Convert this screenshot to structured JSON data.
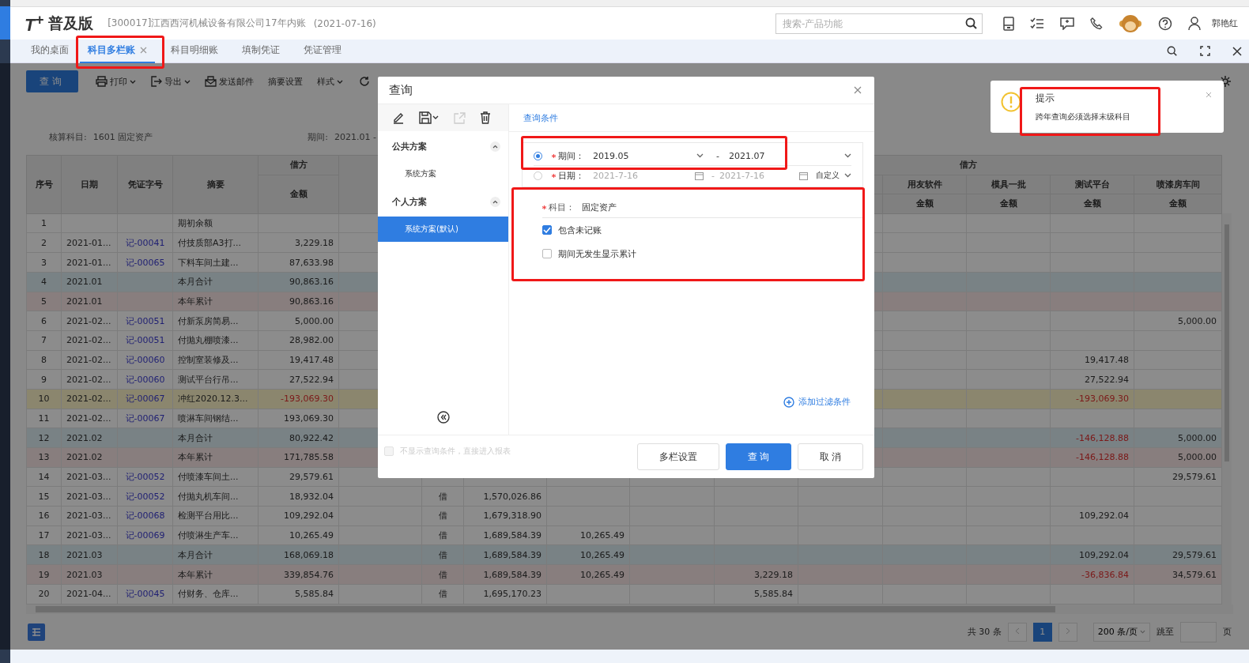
{
  "header": {
    "logo": "T$^{+}$",
    "product": "普及版",
    "company": "[300017]江西西河机械设备有限公司17年内账",
    "date": "(2021-07-16)",
    "search": {
      "placeholder": "搜索-产品功能"
    },
    "user": "郭艳红"
  },
  "tabs": [
    {
      "label": "我的桌面",
      "selected": false
    },
    {
      "label": "科目多栏账",
      "selected": true
    },
    {
      "label": "科目明细账",
      "selected": false
    },
    {
      "label": "填制凭证",
      "selected": false
    },
    {
      "label": "凭证管理",
      "selected": false
    }
  ],
  "toolbar": {
    "query_button": "查询",
    "items": [
      {
        "kind": "print",
        "label": "打印",
        "dropdown": true
      },
      {
        "kind": "export",
        "label": "导出",
        "dropdown": true
      },
      {
        "kind": "mail",
        "label": "发送邮件",
        "dropdown": false
      },
      {
        "kind": "plain",
        "label": "摘要设置",
        "dropdown": false
      },
      {
        "kind": "plain",
        "label": "样式",
        "dropdown": true
      }
    ]
  },
  "filter_summary": {
    "account_label": "核算科目:",
    "account": "1601 固定资产",
    "period_label": "期间:",
    "period": "2021.01 -"
  },
  "table": {
    "header": {
      "seq": "序号",
      "date": "日期",
      "voucher": "凭证字号",
      "summary": "摘要",
      "debit_group": "借方",
      "debit_amount": "金额",
      "right_group": "借方",
      "right_columns": [
        {
          "name": "用友软件",
          "sub": "金额"
        },
        {
          "name": "模具一批",
          "sub": "金额"
        },
        {
          "name": "测试平台",
          "sub": "金额"
        },
        {
          "name": "喷漆房车间",
          "sub": "金额"
        }
      ]
    },
    "rows": [
      {
        "kind": "entry",
        "selected": false,
        "cells": {
          "seq": "1",
          "summary": "期初余额"
        }
      },
      {
        "kind": "entry",
        "selected": false,
        "cells": {
          "seq": "2",
          "date": "2021-01...",
          "voucher": "记-00041",
          "summary": "付技质部A3打...",
          "debit_amount": "3,229.18"
        }
      },
      {
        "kind": "entry",
        "selected": false,
        "cells": {
          "seq": "3",
          "date": "2021-01...",
          "voucher": "记-00065",
          "summary": "下料车间土建...",
          "debit_amount": "87,633.98"
        }
      },
      {
        "kind": "month_total",
        "selected": false,
        "cells": {
          "seq": "4",
          "date": "2021.01",
          "summary": "本月合计",
          "debit_amount": "90,863.16"
        }
      },
      {
        "kind": "year_total",
        "selected": false,
        "cells": {
          "seq": "5",
          "date": "2021.01",
          "summary": "本年累计",
          "debit_amount": "90,863.16"
        }
      },
      {
        "kind": "entry",
        "selected": false,
        "cells": {
          "seq": "6",
          "date": "2021-02...",
          "voucher": "记-00051",
          "summary": "付新泵房简易...",
          "debit_amount": "5,000.00",
          "amount_4": "5,000.00"
        }
      },
      {
        "kind": "entry",
        "selected": false,
        "cells": {
          "seq": "7",
          "date": "2021-02...",
          "voucher": "记-00051",
          "summary": "付抛丸棚喷漆...",
          "debit_amount": "28,982.00"
        }
      },
      {
        "kind": "entry",
        "selected": false,
        "cells": {
          "seq": "8",
          "date": "2021-02...",
          "voucher": "记-00060",
          "summary": "控制室装修及...",
          "debit_amount": "19,417.48",
          "amount_3": "19,417.48"
        }
      },
      {
        "kind": "entry",
        "selected": false,
        "cells": {
          "seq": "9",
          "date": "2021-02...",
          "voucher": "记-00060",
          "summary": "测试平台行吊...",
          "debit_amount": "27,522.94",
          "amount_3": "27,522.94"
        }
      },
      {
        "kind": "entry",
        "selected": true,
        "cells": {
          "seq": "10",
          "date": "2021-02...",
          "voucher": "记-00067",
          "summary": "冲红2020.12.3...",
          "debit_amount": "-193,069.30",
          "amount_3": "-193,069.30"
        }
      },
      {
        "kind": "entry",
        "selected": false,
        "cells": {
          "seq": "11",
          "date": "2021-02...",
          "voucher": "记-00067",
          "summary": "喷淋车间钢结...",
          "debit_amount": "193,069.30"
        }
      },
      {
        "kind": "month_total",
        "selected": false,
        "cells": {
          "seq": "12",
          "date": "2021.02",
          "summary": "本月合计",
          "debit_amount": "80,922.42",
          "amount_3": "-146,128.88",
          "amount_4": "5,000.00"
        }
      },
      {
        "kind": "year_total",
        "selected": false,
        "cells": {
          "seq": "13",
          "date": "2021.02",
          "summary": "本年累计",
          "debit_amount": "171,785.58",
          "amount_3": "-146,128.88",
          "amount_4": "5,000.00"
        }
      },
      {
        "kind": "entry",
        "selected": false,
        "cells": {
          "seq": "14",
          "date": "2021-03...",
          "voucher": "记-00052",
          "summary": "付喷漆车间土...",
          "debit_amount": "29,579.61",
          "amount_4": "29,579.61"
        }
      },
      {
        "kind": "entry",
        "selected": false,
        "cells": {
          "seq": "15",
          "date": "2021-03...",
          "voucher": "记-00052",
          "summary": "付抛丸机车间...",
          "debit_amount": "18,932.04",
          "direction": "借",
          "balance": "1,570,026.86"
        }
      },
      {
        "kind": "entry",
        "selected": false,
        "cells": {
          "seq": "16",
          "date": "2021-03...",
          "voucher": "记-00068",
          "summary": "检测平台用比...",
          "debit_amount": "109,292.04",
          "direction": "借",
          "balance": "1,679,318.90",
          "amount_3": "109,292.04"
        }
      },
      {
        "kind": "entry",
        "selected": false,
        "cells": {
          "seq": "17",
          "date": "2021-03...",
          "voucher": "记-00069",
          "summary": "付喷淋生产车...",
          "debit_amount": "10,265.49",
          "direction": "借",
          "balance": "1,689,584.39",
          "column_9": "10,265.49"
        }
      },
      {
        "kind": "month_total",
        "selected": false,
        "cells": {
          "seq": "18",
          "date": "2021.03",
          "summary": "本月合计",
          "debit_amount": "168,069.18",
          "direction": "借",
          "balance": "1,689,584.39",
          "column_9": "10,265.49",
          "amount_3": "109,292.04",
          "amount_4": "29,579.61"
        }
      },
      {
        "kind": "year_total",
        "selected": false,
        "cells": {
          "seq": "19",
          "date": "2021.03",
          "summary": "本年累计",
          "debit_amount": "339,854.76",
          "direction": "借",
          "balance": "1,689,584.39",
          "column_9": "10,265.49",
          "column_11": "3,229.18",
          "amount_3": "-36,836.84",
          "amount_4": "34,579.61"
        }
      },
      {
        "kind": "entry",
        "selected": false,
        "cells": {
          "seq": "20",
          "date": "2021-04...",
          "voucher": "记-00045",
          "summary": "付财务、仓库...",
          "debit_amount": "5,585.84",
          "direction": "借",
          "balance": "1,695,170.23",
          "column_11": "5,585.84"
        }
      }
    ]
  },
  "pagination": {
    "total": "共 30 条",
    "pages": [
      {
        "label": "1",
        "selected": true
      }
    ],
    "page_size": "200 条/页",
    "jump_label": "跳至",
    "page_unit": "页"
  },
  "dialog": {
    "title": "查询",
    "scheme_groups": [
      {
        "label": "公共方案",
        "expanded": true,
        "items": [
          {
            "label": "系统方案",
            "selected": false
          }
        ]
      },
      {
        "label": "个人方案",
        "expanded": true,
        "items": [
          {
            "label": "系统方案(默认)",
            "selected": true
          }
        ]
      }
    ],
    "section_tab": "查询条件",
    "range_options": [
      {
        "kind": "period",
        "label": "期间：",
        "selected": true,
        "from": "2019.05",
        "separator": "-",
        "to": "2021.07"
      },
      {
        "kind": "date",
        "label": "日期：",
        "selected": false,
        "from": "2021-7-16",
        "separator": "-",
        "to": "2021-7-16",
        "preset": "自定义"
      }
    ],
    "account": {
      "label": "科目：",
      "value": "固定资产"
    },
    "options": [
      {
        "label": "包含未记账",
        "checked": true
      },
      {
        "label": "期间无发生显示累计",
        "checked": false
      }
    ],
    "add_filter": "添加过滤条件",
    "skip_option": {
      "label": "不显示查询条件，直接进入报表",
      "checked": false,
      "disabled": true
    },
    "buttons": [
      {
        "label": "多栏设置",
        "primary": false
      },
      {
        "label": "查 询",
        "primary": true
      },
      {
        "label": "取 消",
        "primary": false
      }
    ]
  },
  "notice": {
    "title": "提示",
    "message": "跨年查询必须选择末级科目"
  }
}
